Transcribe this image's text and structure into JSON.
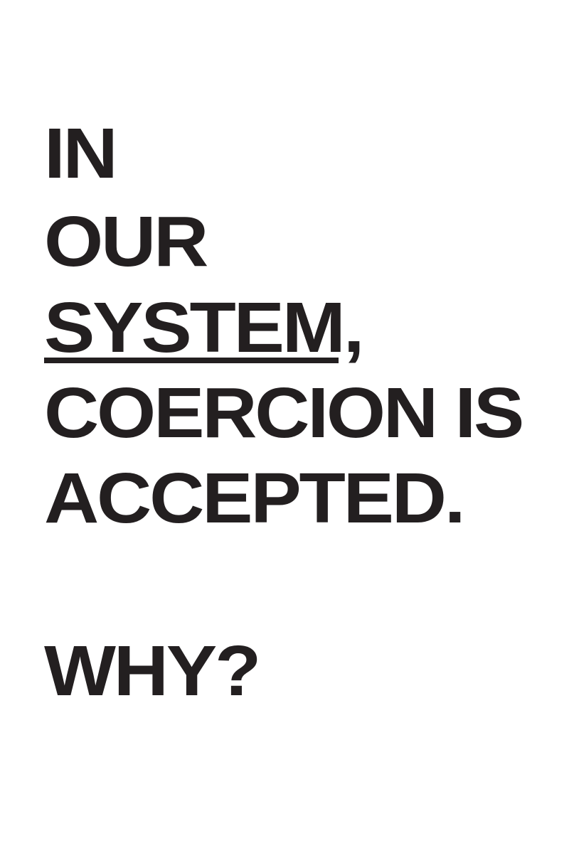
{
  "poster": {
    "lines": [
      "IN",
      "OUR",
      "SYSTEM,",
      "COERCION IS",
      "ACCEPTED.",
      "WHY?"
    ],
    "underlined_word": "SYSTEM",
    "trailing_comma": ",",
    "text_color": "#231f20",
    "background_color": "#ffffff"
  }
}
